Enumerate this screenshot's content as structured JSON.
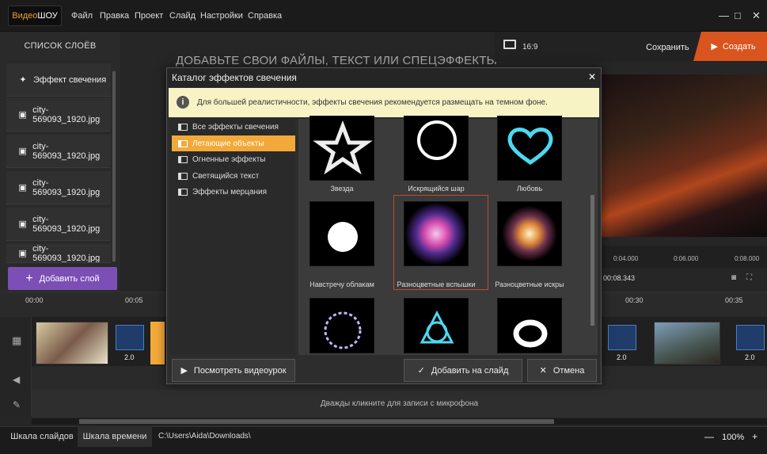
{
  "app": {
    "logo_part1": "Видео",
    "logo_part2": "ШОУ"
  },
  "menu": [
    "Файл",
    "Правка",
    "Проект",
    "Слайд",
    "Настройки",
    "Справка"
  ],
  "window": {
    "minimize": "—",
    "maximize": "□",
    "close": "✕"
  },
  "layers": {
    "title": "СПИСОК СЛОЁВ",
    "items": [
      "Эффект свечения",
      "city-569093_1920.jpg",
      "city-569093_1920.jpg",
      "city-569093_1920.jpg",
      "city-569093_1920.jpg",
      "city-569093_1920.jpg"
    ],
    "add_label": "Добавить слой"
  },
  "center": {
    "title": "ДОБАВЬТЕ СВОИ ФАЙЛЫ, ТЕКСТ ИЛИ СПЕЦЭФФЕКТЫ"
  },
  "preview": {
    "ratio": "16:9",
    "save": "Сохранить",
    "create": "Создать",
    "ticks": [
      "0:04.000",
      "0:06.000",
      "0:08.000"
    ],
    "time": "00:08.343"
  },
  "timeline": {
    "labels": [
      "00:00",
      "00:05",
      "00:30",
      "00:35"
    ],
    "durations": [
      "2.0",
      "2.0",
      "2.0"
    ],
    "mic_hint": "Дважды кликните для записи с микрофона"
  },
  "statusbar": {
    "tab_slides": "Шкала слайдов",
    "tab_time": "Шкала времени",
    "path": "C:\\Users\\Aida\\Downloads\\",
    "zoom": "100%",
    "zoom_minus": "—",
    "zoom_plus": "+"
  },
  "dialog": {
    "title": "Каталог эффектов свечения",
    "close": "✕",
    "notice": "Для большей реалистичности, эффекты свечения рекомендуется размещать на темном фоне.",
    "categories": [
      "Все эффекты свечения",
      "Летающие объекты",
      "Огненные эффекты",
      "Светящийся текст",
      "Эффекты мерцания"
    ],
    "selected_category": 1,
    "effects": [
      "Звезда",
      "Искрящийся шар",
      "Любовь",
      "Навстречу облакам",
      "Разноцветные вспышки",
      "Разноцветные искры"
    ],
    "btn_tutorial": "Посмотреть видеоурок",
    "btn_add": "Добавить на слайд",
    "btn_cancel": "Отмена"
  },
  "colors": {
    "accent_purple": "#7b4fb5",
    "accent_orange": "#d9541e",
    "selected_cat": "#f3a93a",
    "notice_bg": "#f7f3c5"
  }
}
